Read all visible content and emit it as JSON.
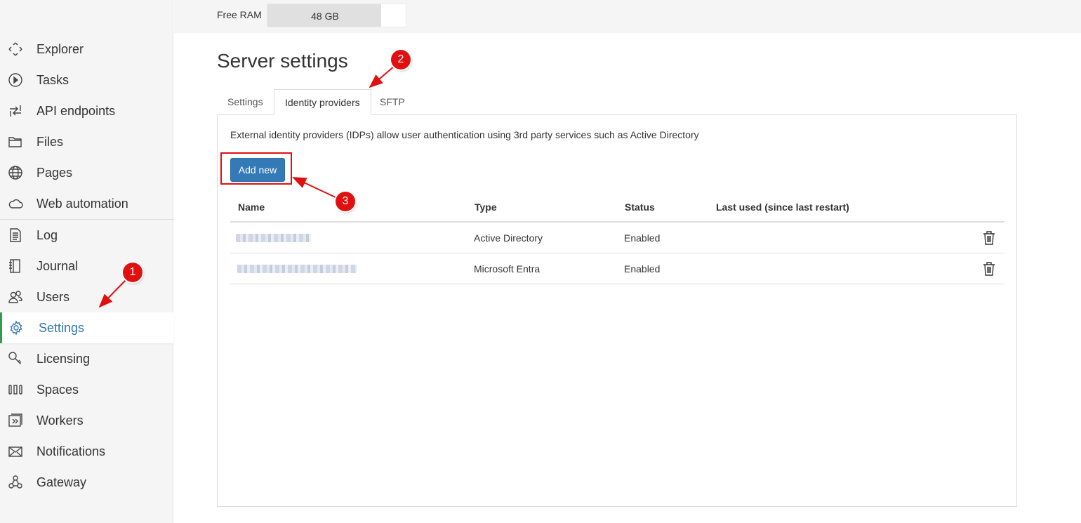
{
  "topbar": {
    "ram_label": "Free RAM",
    "ram_value": "48 GB",
    "ram_used_fraction": 0.82
  },
  "sidebar": {
    "items": [
      {
        "label": "Explorer",
        "icon": "explorer-icon"
      },
      {
        "label": "Tasks",
        "icon": "play-circle-icon"
      },
      {
        "label": "API endpoints",
        "icon": "api-arrows-icon"
      },
      {
        "label": "Files",
        "icon": "folder-icon"
      },
      {
        "label": "Pages",
        "icon": "globe-icon"
      },
      {
        "label": "Web automation",
        "icon": "cloud-icon"
      },
      {
        "label": "Log",
        "icon": "document-icon"
      },
      {
        "label": "Journal",
        "icon": "journal-icon"
      },
      {
        "label": "Users",
        "icon": "users-icon"
      },
      {
        "label": "Settings",
        "icon": "gear-icon",
        "active": true
      },
      {
        "label": "Licensing",
        "icon": "key-icon"
      },
      {
        "label": "Spaces",
        "icon": "spaces-icon"
      },
      {
        "label": "Workers",
        "icon": "workers-icon"
      },
      {
        "label": "Notifications",
        "icon": "envelope-icon"
      },
      {
        "label": "Gateway",
        "icon": "gateway-icon"
      }
    ]
  },
  "main": {
    "title": "Server settings",
    "tabs": [
      {
        "label": "Settings"
      },
      {
        "label": "Identity providers",
        "active": true
      },
      {
        "label": "SFTP"
      }
    ],
    "description": "External identity providers (IDPs) allow user authentication using 3rd party services such as Active Directory",
    "add_button": "Add new",
    "table": {
      "headers": [
        "Name",
        "Type",
        "Status",
        "Last used (since last restart)"
      ],
      "rows": [
        {
          "name": "",
          "type": "Active Directory",
          "status": "Enabled",
          "last_used": ""
        },
        {
          "name": "",
          "type": "Microsoft Entra",
          "status": "Enabled",
          "last_used": ""
        }
      ]
    }
  },
  "annotations": {
    "badge1": "1",
    "badge2": "2",
    "badge3": "3",
    "color": "#e01010"
  },
  "colors": {
    "accent": "#337ab7",
    "active_nav": "#3277b5",
    "active_border": "#2e9e4e"
  }
}
